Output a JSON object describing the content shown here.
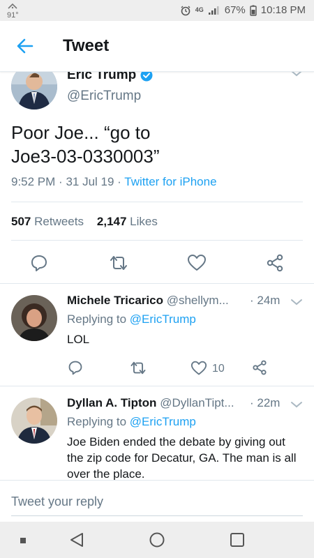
{
  "status_bar": {
    "temp": "91°",
    "network": "4G",
    "battery": "67%",
    "time": "10:18 PM"
  },
  "header": {
    "title": "Tweet",
    "back_icon": "back-arrow-icon"
  },
  "main_tweet": {
    "name": "Eric Trump",
    "handle": "@EricTrump",
    "text_line1": "Poor Joe... “go to",
    "text_line2": "Joe3-03-0330003”",
    "time": "9:52 PM",
    "date": "31 Jul 19",
    "source": "Twitter for iPhone",
    "retweets_count": "507",
    "retweets_label": "Retweets",
    "likes_count": "2,147",
    "likes_label": "Likes"
  },
  "replies": [
    {
      "name": "Michele Tricarico",
      "handle": "@shellym...",
      "time": "· 24m",
      "replying_prefix": "Replying to",
      "replying_to": "@EricTrump",
      "text": "LOL",
      "like_count": "10"
    },
    {
      "name": "Dyllan A. Tipton",
      "handle": "@DyllanTipt...",
      "time": "· 22m",
      "replying_prefix": "Replying to",
      "replying_to": "@EricTrump",
      "text": "Joe Biden ended the debate by giving out the zip code for Decatur, GA. The man is all over the place."
    }
  ],
  "composer": {
    "placeholder": "Tweet your reply"
  },
  "colors": {
    "accent": "#1da1f2",
    "secondary_text": "#657786",
    "primary_text": "#14171a"
  }
}
